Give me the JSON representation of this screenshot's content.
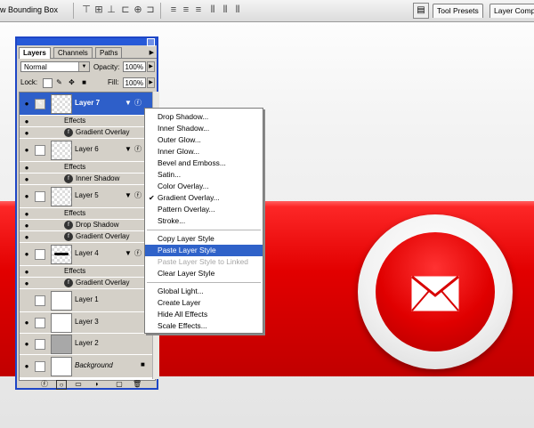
{
  "toolbar": {
    "bounding_box_label": "w Bounding Box",
    "tool_presets_tab": "Tool Presets",
    "layer_comps_tab": "Layer Comp"
  },
  "layers_panel": {
    "tabs": [
      "Layers",
      "Channels",
      "Paths"
    ],
    "blend_mode": "Normal",
    "opacity_label": "Opacity:",
    "opacity_value": "100%",
    "lock_label": "Lock:",
    "fill_label": "Fill:",
    "fill_value": "100%",
    "layers": {
      "layer7": {
        "name": "Layer 7",
        "effects_label": "Effects",
        "effects": [
          "Gradient Overlay"
        ]
      },
      "layer6": {
        "name": "Layer 6",
        "effects_label": "Effects",
        "effects": [
          "Inner Shadow"
        ]
      },
      "layer5": {
        "name": "Layer 5",
        "effects_label": "Effects",
        "effects": [
          "Drop Shadow",
          "Gradient Overlay"
        ]
      },
      "layer4": {
        "name": "Layer 4",
        "effects_label": "Effects",
        "effects": [
          "Gradient Overlay"
        ]
      },
      "layer1": {
        "name": "Layer 1"
      },
      "layer3": {
        "name": "Layer 3"
      },
      "layer2": {
        "name": "Layer 2"
      },
      "background": {
        "name": "Background"
      }
    }
  },
  "context_menu": {
    "items": [
      "Drop Shadow...",
      "Inner Shadow...",
      "Outer Glow...",
      "Inner Glow...",
      "Bevel and Emboss...",
      "Satin...",
      "Color Overlay...",
      "Gradient Overlay...",
      "Pattern Overlay...",
      "Stroke...",
      "Copy Layer Style",
      "Paste Layer Style",
      "Paste Layer Style to Linked",
      "Clear Layer Style",
      "Global Light...",
      "Create Layer",
      "Hide All Effects",
      "Scale Effects..."
    ],
    "checked_item": "Gradient Overlay...",
    "highlighted_item": "Paste Layer Style",
    "disabled_item": "Paste Layer Style to Linked"
  },
  "colors": {
    "banner_red": "#e20000",
    "selection_blue": "#2f62c9",
    "panel_gray": "#d4d0c8"
  },
  "icons": [
    "eye-icon",
    "brush-icon",
    "fx-icon",
    "lock-icon",
    "envelope-icon",
    "chevron-down-icon"
  ]
}
